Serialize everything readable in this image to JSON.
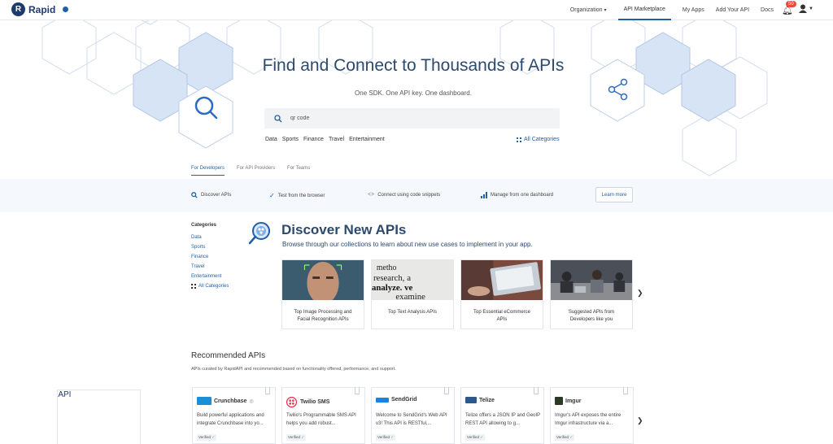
{
  "nav": {
    "logo_text": "Rapid",
    "logo_api": "API",
    "links": [
      "Organization",
      "API Marketplace",
      "My Apps",
      "Add Your API",
      "Docs"
    ],
    "organization_caret": "▾",
    "notification_count": "50"
  },
  "hero": {
    "title": "Find and Connect to Thousands of APIs",
    "subtitle": "One SDK. One API key. One dashboard.",
    "search_value": "qr code",
    "quick_categories": [
      "Data",
      "Sports",
      "Finance",
      "Travel",
      "Entertainment"
    ],
    "all_categories": "All Categories"
  },
  "tabs": [
    "For Developers",
    "For API Providers",
    "For Teams"
  ],
  "features": {
    "items": [
      {
        "icon": "search-icon",
        "label": "Discover APIs"
      },
      {
        "icon": "check-icon",
        "label": "Test from the browser"
      },
      {
        "icon": "code-icon",
        "label": "Connect using code snippets"
      },
      {
        "icon": "bar-chart-icon",
        "label": "Manage from one dashboard"
      }
    ],
    "learn_more": "Learn more"
  },
  "categories": {
    "heading": "Categories",
    "items": [
      "Data",
      "Sports",
      "Finance",
      "Travel",
      "Entertainment"
    ],
    "all": "All Categories"
  },
  "discover": {
    "title": "Discover New APIs",
    "subtitle": "Browse through our collections to learn about new use cases to implement in your app.",
    "collections": [
      {
        "title": "Top Image Processing and Facial Recognition APIs"
      },
      {
        "title": "Top Text Analysis APIs"
      },
      {
        "title": "Top Essential eCommerce APIs"
      },
      {
        "title": "Suggested APIs from Developers like you"
      }
    ]
  },
  "recommended": {
    "title": "Recommended APIs",
    "subtitle": "APIs curated by RapidAPI and recommended based on functionality offered, performance, and support.",
    "verified_label": "Verified",
    "apis": [
      {
        "name": "Crunchbase",
        "desc": "Build powerful applications and integrate Crunchbase into yo...",
        "color": "#1a8fd6"
      },
      {
        "name": "Twilio SMS",
        "desc": "Twilio's Programmable SMS API helps you add robust...",
        "color": "#e4324d"
      },
      {
        "name": "SendGrid",
        "desc": "Welcome to SendGrid's Web API v3! This API is RESTful,...",
        "color": "#1a82e2"
      },
      {
        "name": "Telize",
        "desc": "Telize offers a JSON IP and GeoIP REST API allowing to g...",
        "color": "#2a5a8c"
      },
      {
        "name": "Imgur",
        "desc": "Imgur's API exposes the entire Imgur infrastructure via a...",
        "color": "#2a3a24"
      }
    ]
  },
  "colors": {
    "accent": "#1f5fa8",
    "title": "#2d4a6e",
    "hex_fill": "#d7e4f5",
    "hex_stroke": "#b9cde8"
  }
}
